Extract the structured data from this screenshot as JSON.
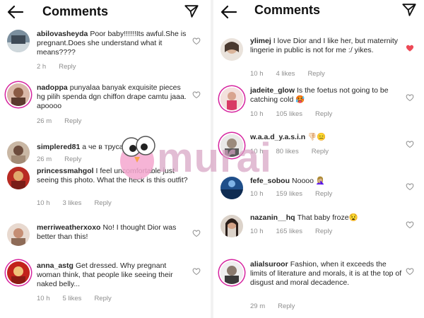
{
  "left": {
    "title": "Comments",
    "comments": [
      {
        "username": "abilovasheyda",
        "text": "Poor baby!!!!!!Its awful.She is pregnant.Does she understand what it means????",
        "time": "2 h",
        "likes": "",
        "reply": "Reply",
        "liked": false
      },
      {
        "username": "nadoppa",
        "text": "punyalaa banyak exquisite pieces hg pilih spenda dgn chiffon drape camtu jaaa. apoooo",
        "time": "26 m",
        "likes": "",
        "reply": "Reply",
        "liked": false
      },
      {
        "username": "simplered81",
        "text": "а че в трусах",
        "time": "26 m",
        "likes": "",
        "reply": "Reply",
        "liked": false
      },
      {
        "username": "princessmahgol",
        "text": "I feel uncomfortable just seeing this photo. What the heck is this outfit?",
        "time": "10 h",
        "likes": "3 likes",
        "reply": "Reply",
        "liked": false
      },
      {
        "username": "merriweatherxoxo",
        "text": "No! I thought Dior was better than this!",
        "time": "",
        "likes": "",
        "reply": "",
        "liked": false
      },
      {
        "username": "anna_astg",
        "text": "Get dressed. Why pregnant woman think, that people like seeing their naked belly...",
        "time": "10 h",
        "likes": "5 likes",
        "reply": "Reply",
        "liked": false
      }
    ]
  },
  "right": {
    "title": "Comments",
    "comments": [
      {
        "username": "ylimej",
        "text": "I love Dior and I like her, but maternity lingerie in public is not for me :/ yikes.",
        "time": "10 h",
        "likes": "4 likes",
        "reply": "Reply",
        "liked": true
      },
      {
        "username": "jadeite_glow",
        "text": "Is the foetus not going to be catching cold 🥵",
        "time": "10 h",
        "likes": "105 likes",
        "reply": "Reply",
        "liked": false
      },
      {
        "username": "w.a.a.d_y.a.s.i.n",
        "text": "👎🏻😑",
        "time": "10 h",
        "likes": "80 likes",
        "reply": "Reply",
        "liked": false
      },
      {
        "username": "fefe_sobou",
        "text": "Noooo 🤦🏼‍♀️",
        "time": "10 h",
        "likes": "159 likes",
        "reply": "Reply",
        "liked": false
      },
      {
        "username": "nazanin__hq",
        "text": "That baby froze😧",
        "time": "10 h",
        "likes": "165 likes",
        "reply": "Reply",
        "liked": false
      },
      {
        "username": "alialsuroor",
        "text": "Fashion, when it exceeds the limits of literature and morals, it is at the top of disgust and moral decadence.",
        "time": "29 m",
        "likes": "",
        "reply": "Reply",
        "liked": false
      }
    ]
  },
  "watermark": {
    "text": "murai",
    "color": "#d7a2c2"
  },
  "colors": {
    "text": "#262626",
    "meta": "#8e8e8e",
    "liked_heart": "#ed4956",
    "story_ring": "#d6249f"
  },
  "icons": {
    "back": "arrow-left-icon",
    "send": "paper-plane-icon",
    "like": "heart-outline-icon",
    "liked": "heart-filled-icon"
  }
}
